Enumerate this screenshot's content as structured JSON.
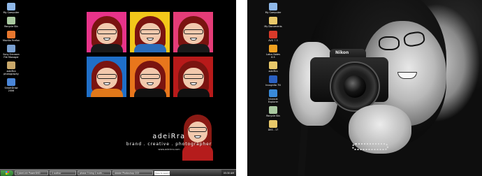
{
  "left_desktop": {
    "icons": [
      {
        "label": "My Computer",
        "icon": "computer-icon",
        "color": "#8fb8e8"
      },
      {
        "label": "Recycle Bin",
        "icon": "recycle-bin-icon",
        "color": "#a9c9a0"
      },
      {
        "label": "Mozilla Firefox",
        "icon": "firefox-icon",
        "color": "#e8772e"
      },
      {
        "label": "Sony Ericsson File Manager",
        "icon": "file-manager-icon",
        "color": "#7aa0d0"
      },
      {
        "label": "adeiRra photography",
        "icon": "photo-folder-icon",
        "color": "#c9a86a"
      },
      {
        "label": "SmartDraw 2006",
        "icon": "smartdraw-icon",
        "color": "#4a86d8"
      }
    ],
    "brand": {
      "name": "adeiRra",
      "tagline": "brand . creative . photographer",
      "url": "www.adeirra.com"
    },
    "tiles": [
      {
        "bg": "#e8338a",
        "shirt": "#1a1a1a"
      },
      {
        "bg": "#f2c71a",
        "shirt": "#2a6bb8"
      },
      {
        "bg": "#e53c78",
        "shirt": "#1a1a1a"
      },
      {
        "bg": "#1f6fc8",
        "shirt": "#e0781a"
      },
      {
        "bg": "#e8761c",
        "shirt": "#111111"
      },
      {
        "bg": "#b81a1a",
        "shirt": "#111111"
      }
    ],
    "taskbar": {
      "items": [
        "CyberLink PowerDVD",
        "2 author",
        "phase 3 bing 2 auth...",
        "Adobe Photoshop CS3"
      ],
      "search_placeholder": "Type to search",
      "clock": "05:30 AM"
    }
  },
  "right_desktop": {
    "icons": [
      {
        "label": "My Computer",
        "icon": "computer-icon",
        "color": "#8fb8e8"
      },
      {
        "label": "My Documents",
        "icon": "documents-folder-icon",
        "color": "#e8c86a"
      },
      {
        "label": "AVG 7.5",
        "icon": "avg-icon",
        "color": "#d83a2a"
      },
      {
        "label": "Lotus Notes 6.5",
        "icon": "lotus-notes-icon",
        "color": "#f0a020"
      },
      {
        "label": "adeiRra",
        "icon": "folder-icon",
        "color": "#e8c86a"
      },
      {
        "label": "Incognito 7N",
        "icon": "incognito-icon",
        "color": "#2a5fc0"
      },
      {
        "label": "Internet Explorer",
        "icon": "internet-explorer-icon",
        "color": "#3a8ad8"
      },
      {
        "label": "Recycle Bin",
        "icon": "recycle-bin-icon",
        "color": "#a9c9a0"
      },
      {
        "label": "DKS - 17",
        "icon": "folder-icon",
        "color": "#e8c86a"
      }
    ],
    "camera_brand": "Nikon"
  }
}
